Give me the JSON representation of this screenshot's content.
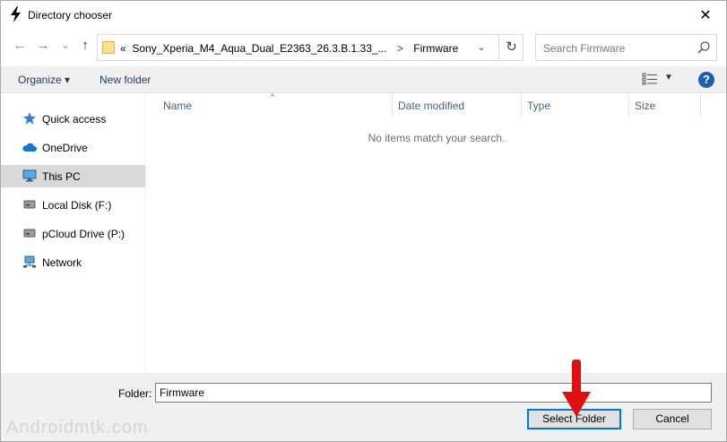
{
  "window": {
    "title": "Directory chooser",
    "close_glyph": "✕"
  },
  "nav": {
    "back_glyph": "←",
    "forward_glyph": "→",
    "recent_glyph": "⌄",
    "up_glyph": "↑"
  },
  "address": {
    "overflow": "«",
    "path_segment_1": "Sony_Xperia_M4_Aqua_Dual_E2363_26.3.B.1.33_...",
    "separator": ">",
    "path_segment_2": "Firmware",
    "dropdown_glyph": "⌄",
    "refresh_glyph": "↻"
  },
  "search": {
    "placeholder": "Search Firmware"
  },
  "toolbar": {
    "organize_label": "Organize ▾",
    "new_folder_label": "New folder",
    "view_dd_glyph": "▼",
    "help_glyph": "?"
  },
  "sidebar": {
    "items": [
      {
        "label": "Quick access",
        "icon": "star-icon"
      },
      {
        "label": "OneDrive",
        "icon": "cloud-icon"
      },
      {
        "label": "This PC",
        "icon": "computer-icon",
        "selected": true
      },
      {
        "label": "Local Disk (F:)",
        "icon": "drive-icon"
      },
      {
        "label": "pCloud Drive (P:)",
        "icon": "drive-icon"
      },
      {
        "label": "Network",
        "icon": "network-icon"
      }
    ]
  },
  "columns": {
    "name": "Name",
    "date_modified": "Date modified",
    "type": "Type",
    "size": "Size",
    "sort_glyph": "^"
  },
  "content": {
    "empty_message": "No items match your search."
  },
  "footer": {
    "folder_label": "Folder:",
    "folder_value": "Firmware",
    "select_button": "Select Folder",
    "cancel_button": "Cancel",
    "watermark": "Androidmtk.com"
  },
  "colors": {
    "annotation_arrow": "#e01010",
    "accent": "#0078d7",
    "selected_nav": "#d9d9d9"
  }
}
